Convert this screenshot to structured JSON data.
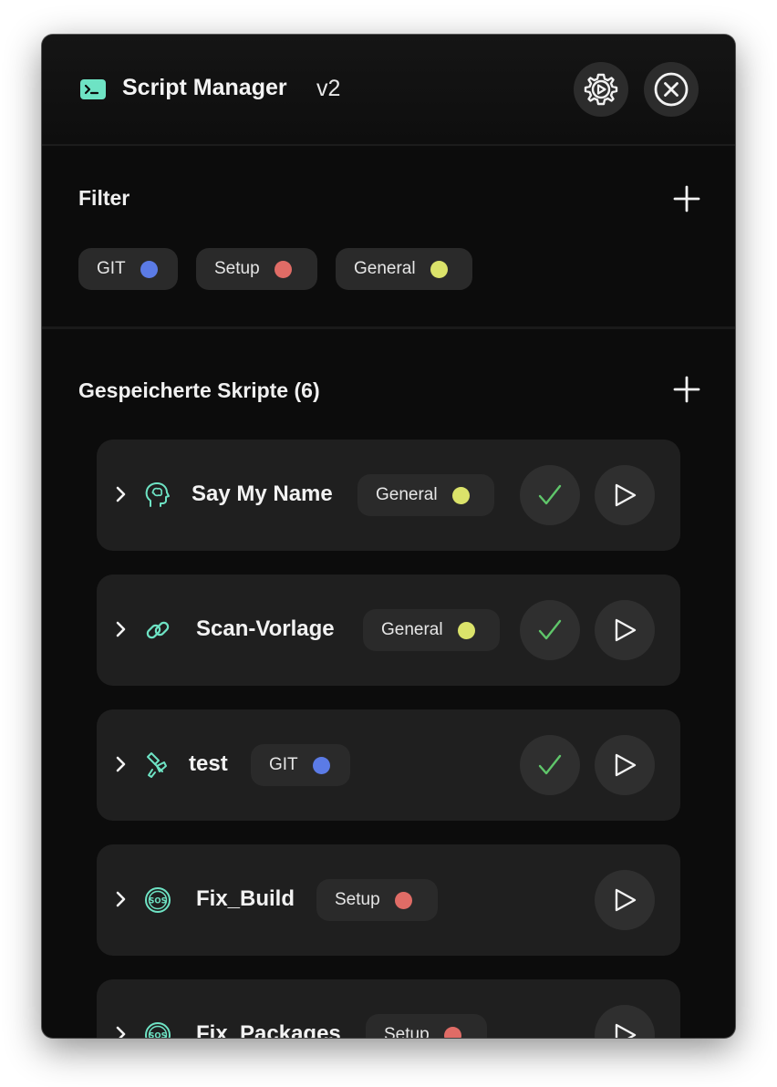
{
  "window": {
    "title": "Script Manager",
    "version": "v2",
    "icons": {
      "app": "terminal-icon",
      "settings": "gear-icon",
      "close": "close-icon"
    }
  },
  "filter": {
    "heading": "Filter",
    "tags": [
      {
        "label": "GIT",
        "color": "#5b7be6"
      },
      {
        "label": "Setup",
        "color": "#e06c66"
      },
      {
        "label": "General",
        "color": "#dbe36a"
      }
    ]
  },
  "scripts": {
    "heading": "Gespeicherte Skripte (6)",
    "items": [
      {
        "name": "Say My Name",
        "tag": "General",
        "tag_color": "#dbe36a",
        "icon": "brain-head-icon",
        "has_check": true
      },
      {
        "name": "Scan-Vorlage",
        "tag": "General",
        "tag_color": "#dbe36a",
        "icon": "link-icon",
        "has_check": true
      },
      {
        "name": "test",
        "tag": "GIT",
        "tag_color": "#5b7be6",
        "icon": "tool-icon",
        "has_check": true
      },
      {
        "name": "Fix_Build",
        "tag": "Setup",
        "tag_color": "#e06c66",
        "icon": "sos-icon",
        "has_check": false
      },
      {
        "name": "Fix_Packages",
        "tag": "Setup",
        "tag_color": "#e06c66",
        "icon": "sos-icon",
        "has_check": false
      }
    ]
  },
  "colors": {
    "accent_teal": "#6ee3c4",
    "check_green": "#5fc66a",
    "background": "#0c0c0c"
  }
}
